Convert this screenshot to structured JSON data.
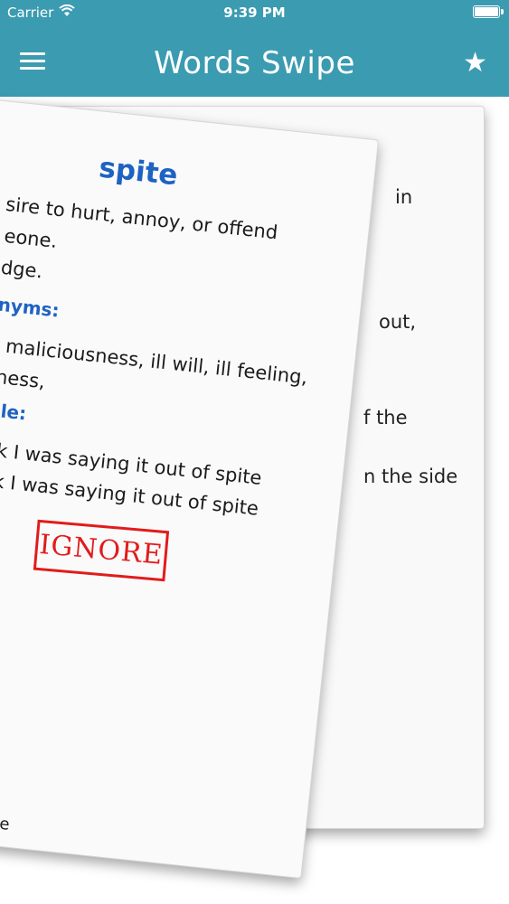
{
  "status_bar": {
    "carrier": "Carrier",
    "time": "9:39 PM"
  },
  "nav": {
    "title": "Words Swipe",
    "star": "★"
  },
  "back_card": {
    "fragments": [
      "in",
      "out,",
      "f the",
      "n the side"
    ]
  },
  "front_card": {
    "word": "spite",
    "definition_lines": [
      "sire to hurt, annoy, or offend",
      "eone.",
      "dge."
    ],
    "synonyms_label": "nyms:",
    "synonyms_lines": [
      ", maliciousness, ill will, ill feeling,",
      "lness,"
    ],
    "example_label": "ple:",
    "example_lines": [
      "nk I was saying it out of spite",
      "nk I was saying it out of spite"
    ],
    "stamp": "IGNORE",
    "footer": "s Swipe"
  },
  "colors": {
    "header": "#3b9bb1",
    "word": "#1e63c2",
    "stamp": "#e21b1b"
  }
}
